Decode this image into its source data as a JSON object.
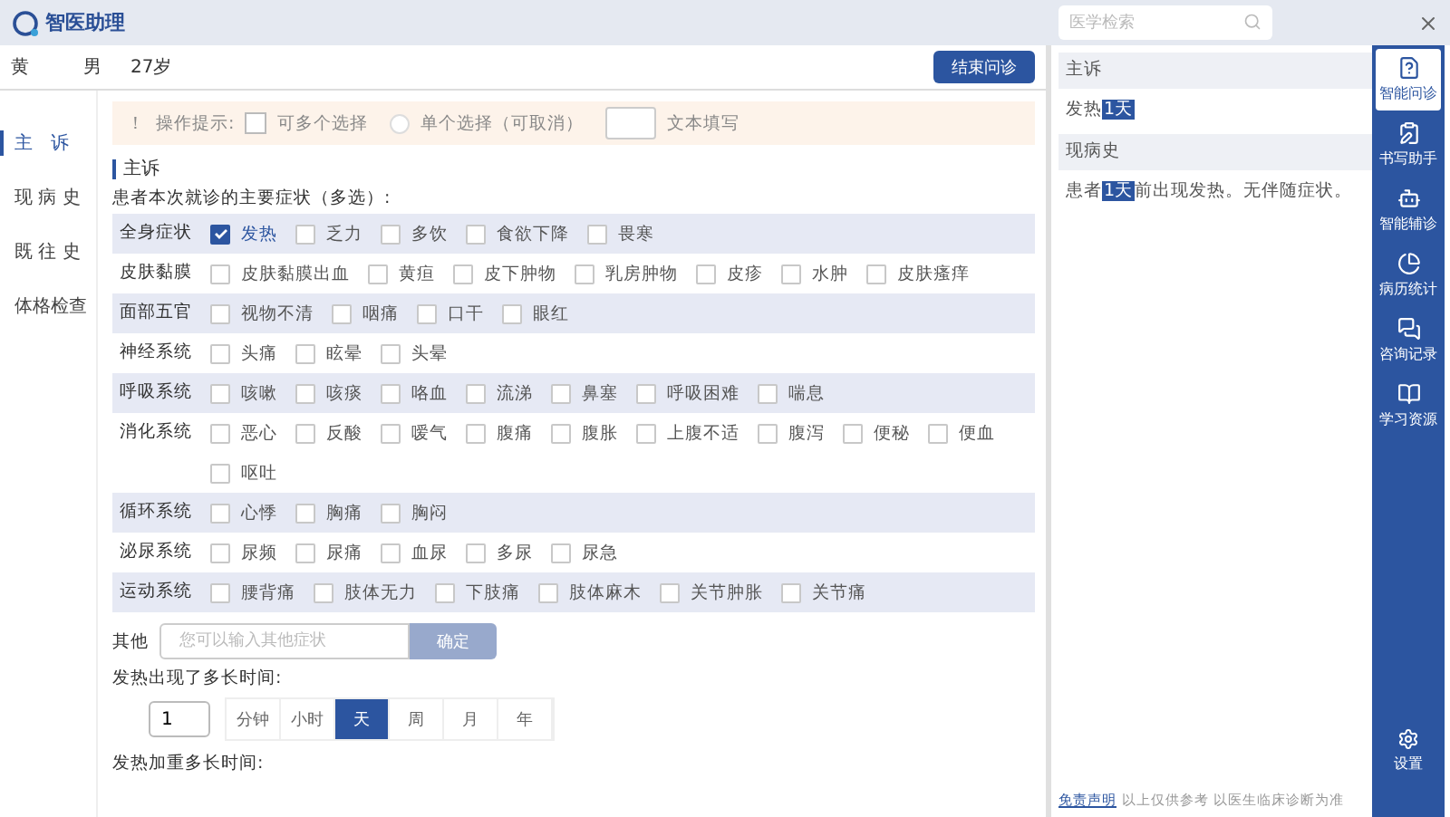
{
  "app": {
    "name": "智医助理"
  },
  "search": {
    "placeholder": "医学检索"
  },
  "patient": {
    "name": "黄",
    "gender": "男",
    "age": "27岁"
  },
  "end_button": "结束问诊",
  "nav": [
    {
      "label": "主　诉",
      "selected": true
    },
    {
      "label": "现 病 史",
      "selected": false
    },
    {
      "label": "既 往 史",
      "selected": false
    },
    {
      "label": "体格检查",
      "selected": false
    }
  ],
  "hint": {
    "mark": "！",
    "label": "操作提示:",
    "items": [
      {
        "kind": "checkbox",
        "label": "可多个选择"
      },
      {
        "kind": "radio",
        "label": "单个选择（可取消）"
      },
      {
        "kind": "text",
        "label": "文本填写"
      }
    ]
  },
  "section_title": "主诉",
  "question": "患者本次就诊的主要症状（多选）:",
  "symptoms": [
    {
      "category": "全身症状",
      "options": [
        {
          "label": "发热",
          "checked": true
        },
        {
          "label": "乏力",
          "checked": false
        },
        {
          "label": "多饮",
          "checked": false
        },
        {
          "label": "食欲下降",
          "checked": false
        },
        {
          "label": "畏寒",
          "checked": false
        }
      ]
    },
    {
      "category": "皮肤黏膜",
      "options": [
        {
          "label": "皮肤黏膜出血",
          "checked": false
        },
        {
          "label": "黄疸",
          "checked": false
        },
        {
          "label": "皮下肿物",
          "checked": false
        },
        {
          "label": "乳房肿物",
          "checked": false
        },
        {
          "label": "皮疹",
          "checked": false
        },
        {
          "label": "水肿",
          "checked": false
        },
        {
          "label": "皮肤瘙痒",
          "checked": false
        }
      ]
    },
    {
      "category": "面部五官",
      "options": [
        {
          "label": "视物不清",
          "checked": false
        },
        {
          "label": "咽痛",
          "checked": false
        },
        {
          "label": "口干",
          "checked": false
        },
        {
          "label": "眼红",
          "checked": false
        }
      ]
    },
    {
      "category": "神经系统",
      "options": [
        {
          "label": "头痛",
          "checked": false
        },
        {
          "label": "眩晕",
          "checked": false
        },
        {
          "label": "头晕",
          "checked": false
        }
      ]
    },
    {
      "category": "呼吸系统",
      "options": [
        {
          "label": "咳嗽",
          "checked": false
        },
        {
          "label": "咳痰",
          "checked": false
        },
        {
          "label": "咯血",
          "checked": false
        },
        {
          "label": "流涕",
          "checked": false
        },
        {
          "label": "鼻塞",
          "checked": false
        },
        {
          "label": "呼吸困难",
          "checked": false
        },
        {
          "label": "喘息",
          "checked": false
        }
      ]
    },
    {
      "category": "消化系统",
      "options": [
        {
          "label": "恶心",
          "checked": false
        },
        {
          "label": "反酸",
          "checked": false
        },
        {
          "label": "嗳气",
          "checked": false
        },
        {
          "label": "腹痛",
          "checked": false
        },
        {
          "label": "腹胀",
          "checked": false
        },
        {
          "label": "上腹不适",
          "checked": false
        },
        {
          "label": "腹泻",
          "checked": false
        },
        {
          "label": "便秘",
          "checked": false
        },
        {
          "label": "便血",
          "checked": false
        },
        {
          "label": "呕吐",
          "checked": false
        }
      ]
    },
    {
      "category": "循环系统",
      "options": [
        {
          "label": "心悸",
          "checked": false
        },
        {
          "label": "胸痛",
          "checked": false
        },
        {
          "label": "胸闷",
          "checked": false
        }
      ]
    },
    {
      "category": "泌尿系统",
      "options": [
        {
          "label": "尿频",
          "checked": false
        },
        {
          "label": "尿痛",
          "checked": false
        },
        {
          "label": "血尿",
          "checked": false
        },
        {
          "label": "多尿",
          "checked": false
        },
        {
          "label": "尿急",
          "checked": false
        }
      ]
    },
    {
      "category": "运动系统",
      "options": [
        {
          "label": "腰背痛",
          "checked": false
        },
        {
          "label": "肢体无力",
          "checked": false
        },
        {
          "label": "下肢痛",
          "checked": false
        },
        {
          "label": "肢体麻木",
          "checked": false
        },
        {
          "label": "关节肿胀",
          "checked": false
        },
        {
          "label": "关节痛",
          "checked": false
        }
      ]
    }
  ],
  "other": {
    "label": "其他",
    "placeholder": "您可以输入其他症状",
    "button": "确定"
  },
  "duration": {
    "question": "发热出现了多长时间:",
    "value": "1",
    "units": [
      {
        "label": "分钟",
        "selected": false
      },
      {
        "label": "小时",
        "selected": false
      },
      {
        "label": "天",
        "selected": true
      },
      {
        "label": "周",
        "selected": false
      },
      {
        "label": "月",
        "selected": false
      },
      {
        "label": "年",
        "selected": false
      }
    ]
  },
  "next_question": "发热加重多长时间:",
  "summary": [
    {
      "title": "主诉",
      "text": "发热**1天**"
    },
    {
      "title": "现病史",
      "text": "患者**1天**前出现发热。无伴随症状。"
    }
  ],
  "disclaimer": {
    "link": "免责声明",
    "text": "以上仅供参考 以医生临床诊断为准"
  },
  "sidebar": [
    {
      "kind": "question",
      "label": "智能问诊",
      "selected": true
    },
    {
      "kind": "write",
      "label": "书写助手",
      "selected": false
    },
    {
      "kind": "bot",
      "label": "智能辅诊",
      "selected": false
    },
    {
      "kind": "stats",
      "label": "病历统计",
      "selected": false
    },
    {
      "kind": "chat",
      "label": "咨询记录",
      "selected": false
    },
    {
      "kind": "book",
      "label": "学习资源",
      "selected": false
    }
  ],
  "settings": "设置"
}
